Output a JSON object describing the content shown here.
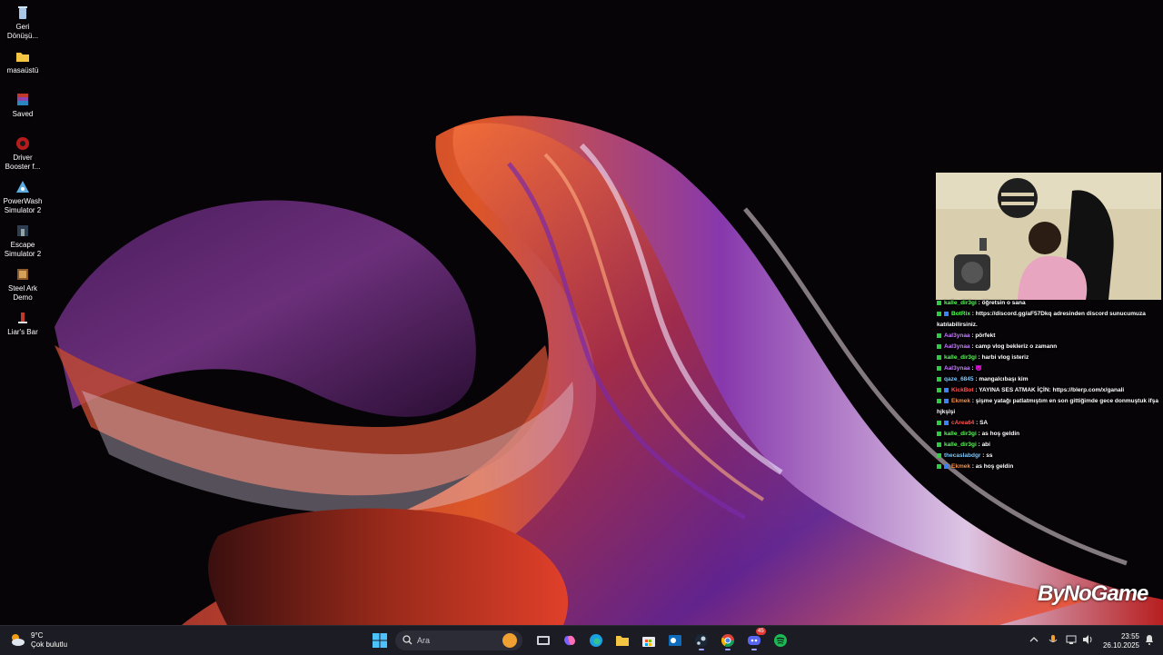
{
  "desktop": {
    "icons": [
      {
        "label": "Geri Dönüşü...",
        "icon": "recycle-bin-icon"
      },
      {
        "label": "masaüstü",
        "icon": "folder-icon"
      },
      {
        "label": "Saved",
        "icon": "winrar-icon"
      },
      {
        "label": "Driver Booster f...",
        "icon": "driver-booster-icon"
      },
      {
        "label": "PowerWash Simulator 2",
        "icon": "powerwash-icon"
      },
      {
        "label": "Escape Simulator 2",
        "icon": "escape-simulator-icon"
      },
      {
        "label": "Steel Ark Demo",
        "icon": "steel-ark-icon"
      },
      {
        "label": "Liar's Bar",
        "icon": "liars-bar-icon"
      }
    ]
  },
  "stream_overlay": {
    "chat": [
      {
        "user": "kalle_dir3gi",
        "user_color": "#55ff55",
        "text": "öğretsin o sana"
      },
      {
        "user": "BotRix",
        "user_color": "#55ff55",
        "text": "https://discord.gg/aF57Dkq adresinden discord sunucumuza katılabilirsiniz."
      },
      {
        "user": "Aal3ynaa",
        "user_color": "#c77dff",
        "text": "pörfekt"
      },
      {
        "user": "Aal3ynaa",
        "user_color": "#c77dff",
        "text": "camp vlog bekleriz o zamann"
      },
      {
        "user": "kalle_dir3gi",
        "user_color": "#55ff55",
        "text": "harbi vlog isteriz"
      },
      {
        "user": "Aal3ynaa",
        "user_color": "#c77dff",
        "text": "😈"
      },
      {
        "user": "qaze_6845",
        "user_color": "#7ec8ff",
        "text": "mangalcıbaşı kim"
      },
      {
        "user": "KickBot",
        "user_color": "#ff5555",
        "text": "YAYINA SES ATMAK İÇİN: https://blerp.com/x/ganali"
      },
      {
        "user": "Ekmek",
        "user_color": "#ff8c42",
        "text": "şişme yatağı patlatmıştım en son gittiğimde gece donmuştuk ifşa hjkşlşi"
      },
      {
        "user": "cArea64",
        "user_color": "#ff5555",
        "text": "SA"
      },
      {
        "user": "kalle_dir3gi",
        "user_color": "#55ff55",
        "text": "as hoş geldin"
      },
      {
        "user": "kalle_dir3gi",
        "user_color": "#55ff55",
        "text": "abi"
      },
      {
        "user": "thecaslabdgr",
        "user_color": "#7ec8ff",
        "text": "ss"
      },
      {
        "user": "Ekmek",
        "user_color": "#ff8c42",
        "text": "as hoş geldin"
      }
    ],
    "watermark": "ByNoGame"
  },
  "taskbar": {
    "weather": {
      "temp": "9°C",
      "condition": "Çok bulutlu"
    },
    "search_placeholder": "Ara",
    "clock": {
      "time": "23:55",
      "date": "26.10.2025"
    },
    "apps": [
      {
        "name": "start-button",
        "icon": "windows-icon"
      },
      {
        "name": "task-view-button",
        "icon": "task-view-icon"
      },
      {
        "name": "copilot-button",
        "icon": "copilot-icon"
      },
      {
        "name": "edge-button",
        "icon": "edge-icon"
      },
      {
        "name": "explorer-button",
        "icon": "folder-icon"
      },
      {
        "name": "store-button",
        "icon": "store-icon"
      },
      {
        "name": "outlook-button",
        "icon": "outlook-icon"
      },
      {
        "name": "steam-button",
        "icon": "steam-icon"
      },
      {
        "name": "chrome-button",
        "icon": "chrome-icon"
      },
      {
        "name": "discord-button",
        "icon": "discord-icon"
      },
      {
        "name": "spotify-button",
        "icon": "spotify-icon"
      }
    ],
    "discord_badge": "45"
  }
}
